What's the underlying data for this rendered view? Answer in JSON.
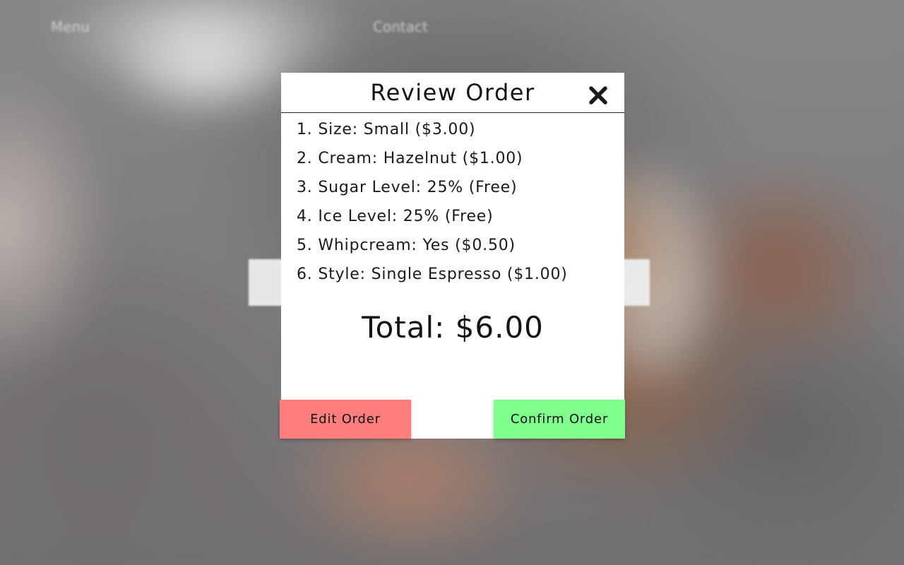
{
  "nav": {
    "menu_label": "Menu",
    "contact_label": "Contact"
  },
  "modal": {
    "title": "Review Order",
    "close_icon": "close-icon",
    "items": [
      "1. Size: Small ($3.00)",
      "2. Cream: Hazelnut ($1.00)",
      "3. Sugar Level: 25% (Free)",
      "4. Ice Level: 25% (Free)",
      "5. Whipcream: Yes ($0.50)",
      "6. Style: Single Espresso ($1.00)"
    ],
    "total": "Total: $6.00",
    "edit_label": "Edit Order",
    "confirm_label": "Confirm Order"
  },
  "colors": {
    "edit_button": "#ff7f7f",
    "confirm_button": "#80ff8f",
    "modal_background": "#ffffff"
  }
}
